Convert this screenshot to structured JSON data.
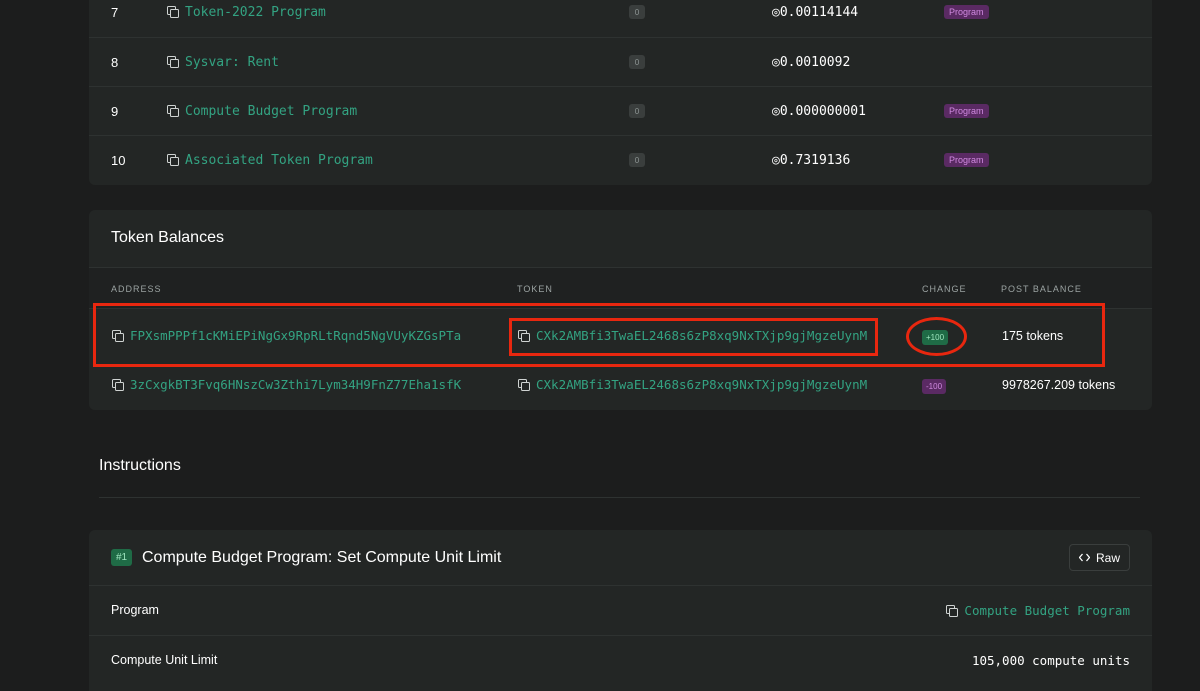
{
  "accounts": {
    "rows": [
      {
        "index": "7",
        "name": "Token-2022 Program",
        "badge": "0",
        "balance": "◎0.00114144",
        "tag": "Program"
      },
      {
        "index": "8",
        "name": "Sysvar: Rent",
        "badge": "0",
        "balance": "◎0.0010092",
        "tag": ""
      },
      {
        "index": "9",
        "name": "Compute Budget Program",
        "badge": "0",
        "balance": "◎0.000000001",
        "tag": "Program"
      },
      {
        "index": "10",
        "name": "Associated Token Program",
        "badge": "0",
        "balance": "◎0.7319136",
        "tag": "Program"
      }
    ]
  },
  "token_balances": {
    "title": "Token Balances",
    "headers": {
      "address": "ADDRESS",
      "token": "TOKEN",
      "change": "CHANGE",
      "post_balance": "POST BALANCE"
    },
    "rows": [
      {
        "address": "FPXsmPPPf1cKMiEPiNgGx9RpRLtRqnd5NgVUyKZGsPTa",
        "token": "CXk2AMBfi3TwaEL2468s6zP8xq9NxTXjp9gjMgzeUynM",
        "change": "+100",
        "post_balance": "175 tokens"
      },
      {
        "address": "3zCxgkBT3Fvq6HNszCw3Zthi7Lym34H9FnZ77Eha1sfK",
        "token": "CXk2AMBfi3TwaEL2468s6zP8xq9NxTXjp9gjMgzeUynM",
        "change": "-100",
        "post_balance": "9978267.209 tokens"
      }
    ]
  },
  "instructions": {
    "title": "Instructions",
    "items": [
      {
        "badge": "#1",
        "title": "Compute Budget Program: Set Compute Unit Limit",
        "raw_label": "Raw",
        "rows": [
          {
            "key": "Program",
            "value": "Compute Budget Program"
          },
          {
            "key": "Compute Unit Limit",
            "value": "105,000 compute units"
          }
        ]
      }
    ]
  },
  "colors": {
    "background": "#1c1d1d",
    "card": "#232625",
    "link": "#33a382",
    "annotation": "#e8270f",
    "program_badge": "#5a2a63",
    "positive_badge": "#1f6b46"
  }
}
